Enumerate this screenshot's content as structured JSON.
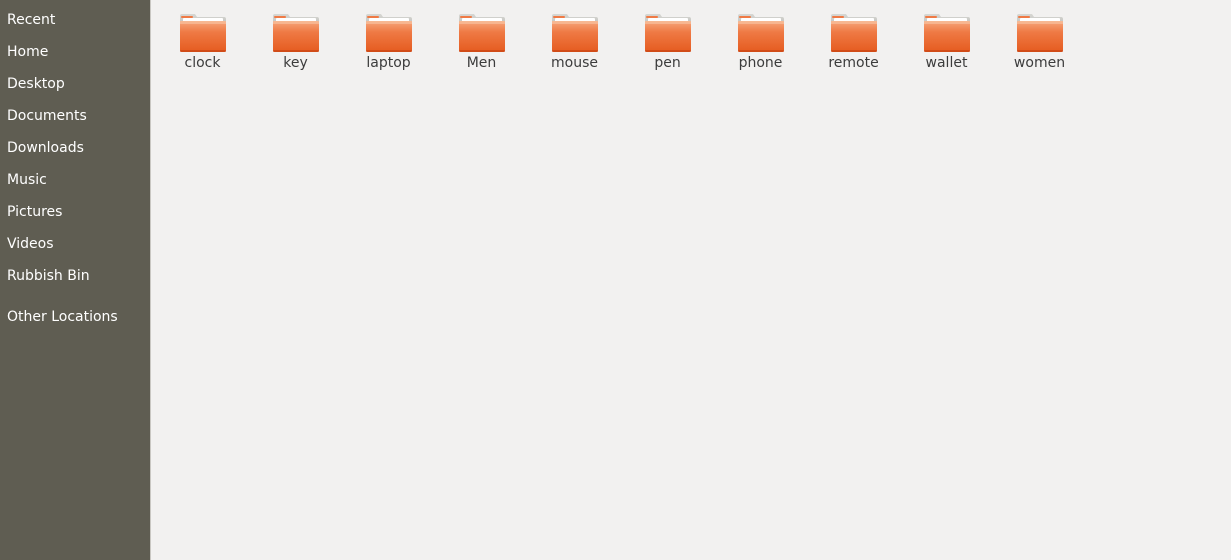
{
  "sidebar": {
    "items": [
      {
        "label": "Recent",
        "name": "sidebar-item-recent"
      },
      {
        "label": "Home",
        "name": "sidebar-item-home"
      },
      {
        "label": "Desktop",
        "name": "sidebar-item-desktop"
      },
      {
        "label": "Documents",
        "name": "sidebar-item-documents"
      },
      {
        "label": "Downloads",
        "name": "sidebar-item-downloads"
      },
      {
        "label": "Music",
        "name": "sidebar-item-music"
      },
      {
        "label": "Pictures",
        "name": "sidebar-item-pictures"
      },
      {
        "label": "Videos",
        "name": "sidebar-item-videos"
      },
      {
        "label": "Rubbish Bin",
        "name": "sidebar-item-rubbish-bin"
      }
    ],
    "other_locations": "Other Locations"
  },
  "folders": [
    {
      "name": "clock",
      "icon": "folder-icon"
    },
    {
      "name": "key",
      "icon": "folder-icon"
    },
    {
      "name": "laptop",
      "icon": "folder-icon"
    },
    {
      "name": "Men",
      "icon": "folder-icon"
    },
    {
      "name": "mouse",
      "icon": "folder-icon"
    },
    {
      "name": "pen",
      "icon": "folder-icon"
    },
    {
      "name": "phone",
      "icon": "folder-icon"
    },
    {
      "name": "remote",
      "icon": "folder-icon"
    },
    {
      "name": "wallet",
      "icon": "folder-icon"
    },
    {
      "name": "women",
      "icon": "folder-icon"
    }
  ],
  "colors": {
    "sidebar_bg": "#5f5d52",
    "main_bg": "#f2f1f0",
    "folder_orange": "#e95420"
  }
}
